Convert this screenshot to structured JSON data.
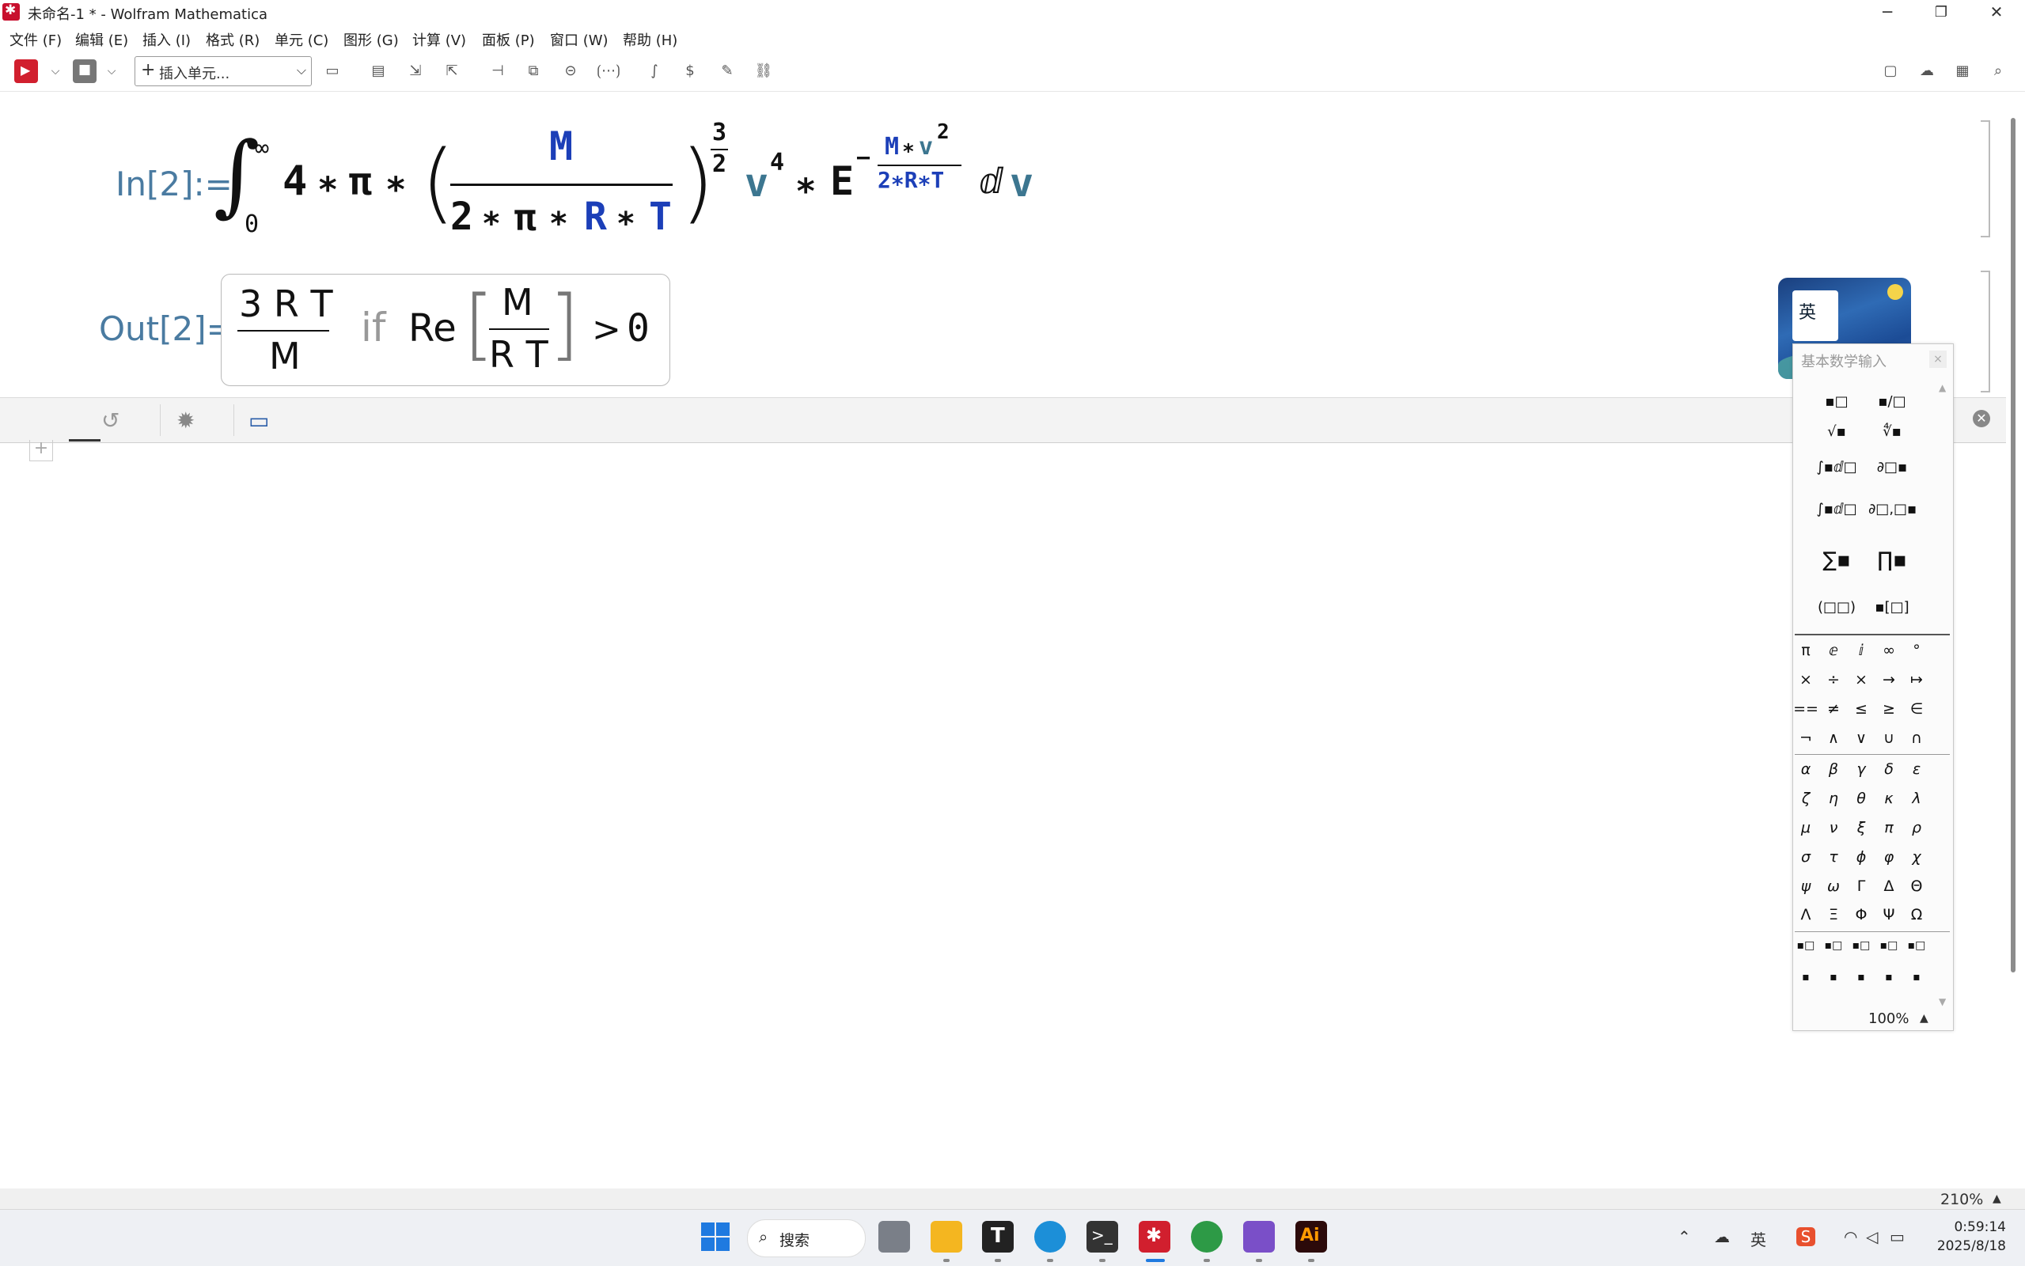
{
  "window": {
    "title": "未命名-1 * - Wolfram Mathematica",
    "minimize": "─",
    "maximize": "❐",
    "close": "✕"
  },
  "menu": [
    "文件 (F)",
    "编辑 (E)",
    "插入 (I)",
    "格式 (R)",
    "单元 (C)",
    "图形 (G)",
    "计算 (V)",
    "面板 (P)",
    "窗口 (W)",
    "帮助 (H)"
  ],
  "toolbar": {
    "cell_style_placeholder": "插入单元...",
    "plus": "+",
    "dropdown_arrow": "⌵"
  },
  "notebook": {
    "in_label": "In[2]:=",
    "out_label": "Out[2]=",
    "input": {
      "integral": "∫",
      "upper": "∞",
      "lower": "0",
      "four": "4",
      "star": "∗",
      "pi": "π",
      "frac_num": "M",
      "frac_den_two": "2",
      "frac_den_R": "R",
      "frac_den_T": "T",
      "power_num": "3",
      "power_den": "2",
      "v": "v",
      "v_exp": "4",
      "E": "E",
      "minus": "−",
      "exp_num_M": "M",
      "exp_num_v": "v",
      "exp_num_2": "2",
      "exp_den": "2∗R∗T",
      "d": "ⅆ",
      "dv": "v"
    },
    "output": {
      "num": "3 R T",
      "den": "M",
      "if": "if",
      "re": "Re",
      "re_num": "M",
      "re_den": "R T",
      "gt": ">",
      "zero": "0"
    },
    "widget_text": "英"
  },
  "cellbar": {
    "close": "✕",
    "add": "+"
  },
  "palette": {
    "title": "基本数学输入",
    "close": "×",
    "templates": [
      "▪□",
      "▪/□",
      "√▪",
      "∜▪",
      "∫▪ⅆ□",
      "∂□▪",
      "∫▪ⅆ□",
      "∂□,□▪",
      "∑▪",
      "∏▪",
      "(□□)",
      "▪[□]"
    ],
    "symbols_row1": [
      "π",
      "ⅇ",
      "ⅈ",
      "∞",
      "°"
    ],
    "symbols_row2": [
      "×",
      "÷",
      "×",
      "→",
      "↦"
    ],
    "symbols_row3": [
      "==",
      "≠",
      "≤",
      "≥",
      "∈"
    ],
    "symbols_row4": [
      "¬",
      "∧",
      "∨",
      "∪",
      "∩"
    ],
    "greek_row1": [
      "α",
      "β",
      "γ",
      "δ",
      "ε"
    ],
    "greek_row2": [
      "ζ",
      "η",
      "θ",
      "κ",
      "λ"
    ],
    "greek_row3": [
      "μ",
      "ν",
      "ξ",
      "π",
      "ρ"
    ],
    "greek_row4": [
      "σ",
      "τ",
      "ϕ",
      "φ",
      "χ"
    ],
    "greek_row5": [
      "ψ",
      "ω",
      "Γ",
      "Δ",
      "Θ"
    ],
    "greek_row6": [
      "Λ",
      "Ξ",
      "Φ",
      "Ψ",
      "Ω"
    ],
    "sub_row1": [
      "▪□",
      "▪□",
      "▪□",
      "▪□",
      "▪□"
    ],
    "sub_row2": [
      "▪",
      "▪",
      "▪",
      "▪",
      "▪"
    ],
    "zoom": "100%"
  },
  "status": {
    "zoom": "210%"
  },
  "taskbar": {
    "search": "搜索",
    "ime": "英",
    "time": "0:59:14",
    "date": "2025/8/18"
  }
}
